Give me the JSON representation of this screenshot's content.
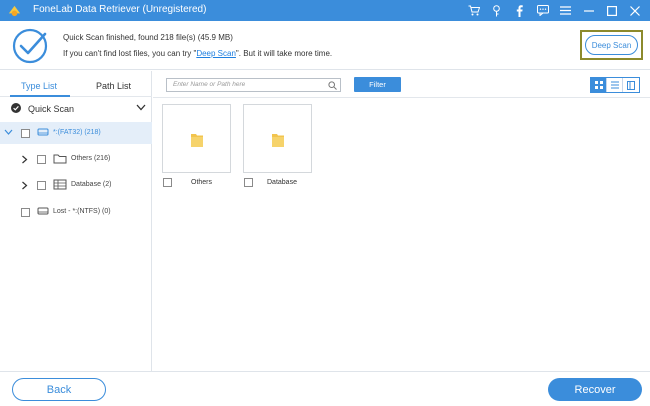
{
  "window": {
    "title": "FoneLab Data Retriever (Unregistered)",
    "icons": [
      "cart-icon",
      "key-icon",
      "facebook-icon",
      "chat-icon",
      "menu-icon",
      "minimize-icon",
      "maximize-icon",
      "close-icon"
    ]
  },
  "status": {
    "line1": "Quick Scan finished, found 218 file(s) (45.9 MB)",
    "line2_prefix": "If you can't find lost files, you can try \"",
    "line2_link": "Deep Scan",
    "line2_suffix": "\". But it will take more time.",
    "deep_scan_label": "Deep Scan"
  },
  "sidebar": {
    "tabs": [
      {
        "label": "Type List",
        "active": true
      },
      {
        "label": "Path List",
        "active": false
      }
    ],
    "quick_scan_label": "Quick Scan",
    "tree": [
      {
        "label": "*:(FAT32) (218)",
        "icon": "drive-icon",
        "selected": true,
        "expanded": true
      },
      {
        "label": "Others (216)",
        "icon": "folder-icon",
        "selected": false
      },
      {
        "label": "Database (2)",
        "icon": "database-icon",
        "selected": false
      },
      {
        "label": "Lost - *:(NTFS) (0)",
        "icon": "drive-icon",
        "selected": false
      }
    ]
  },
  "toolbar": {
    "search_placeholder": "Enter Name or Path here",
    "filter_label": "Filter",
    "view_modes": [
      "grid-view-icon",
      "list-view-icon",
      "detail-view-icon"
    ],
    "active_view": "grid-view-icon"
  },
  "files": [
    {
      "label": "Others",
      "icon": "folder-icon"
    },
    {
      "label": "Database",
      "icon": "folder-icon"
    }
  ],
  "footer": {
    "back_label": "Back",
    "recover_label": "Recover"
  },
  "colors": {
    "accent": "#3b8ddb",
    "folder": "#f2c44e",
    "highlight_border": "#8c8a2c"
  }
}
